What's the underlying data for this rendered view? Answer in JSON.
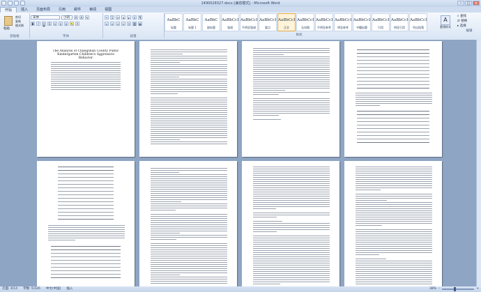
{
  "window": {
    "title": "1490028327.docx [兼容模式] - Microsoft Word",
    "minimize": "–",
    "maximize": "□",
    "close": "✕"
  },
  "menu": [
    "开始",
    "插入",
    "页面布局",
    "引用",
    "邮件",
    "审阅",
    "视图"
  ],
  "ribbon": {
    "clipboard": {
      "paste": "粘贴",
      "cut": "剪切",
      "copy": "复制",
      "format_painter": "格式刷",
      "label": "剪贴板"
    },
    "font": {
      "name": "宋体",
      "size": "小四",
      "label": "字体"
    },
    "paragraph": {
      "label": "段落"
    },
    "styles": {
      "label": "样式",
      "items": [
        {
          "sample": "AaBbC",
          "name": "标题"
        },
        {
          "sample": "AaBbC",
          "name": "标题 1"
        },
        {
          "sample": "AaBbC",
          "name": "副标题"
        },
        {
          "sample": "AaBbCcD",
          "name": "强调"
        },
        {
          "sample": "AaBbCcD",
          "name": "不明显强调"
        },
        {
          "sample": "AaBbCcD",
          "name": "要点"
        },
        {
          "sample": "AaBbCcD",
          "name": "正文"
        },
        {
          "sample": "AaBbCcD",
          "name": "无间隔"
        },
        {
          "sample": "AaBbCcD",
          "name": "不明显参考"
        },
        {
          "sample": "AaBbCcD",
          "name": "明显参考"
        },
        {
          "sample": "AaBbCcD",
          "name": "书籍标题"
        },
        {
          "sample": "AaBbCcD",
          "name": "引用"
        },
        {
          "sample": "AaBbCcD",
          "name": "明显引用"
        },
        {
          "sample": "AaBbCcD",
          "name": "列出段落"
        }
      ]
    },
    "change_styles": "更改样式",
    "editing": {
      "find": "查找",
      "replace": "替换",
      "select": "选择",
      "label": "编辑"
    }
  },
  "pages": [
    {
      "title": "The Analysis of Changshan County Public Kindergarten Children's Aggressive Behavior"
    },
    {},
    {},
    {},
    {},
    {},
    {},
    {}
  ],
  "status": {
    "page": "页面: 4/14",
    "words": "字数: 9,026",
    "language": "中文(中国)",
    "mode": "插入",
    "zoom": "38%"
  },
  "zoom_level": 0.38
}
